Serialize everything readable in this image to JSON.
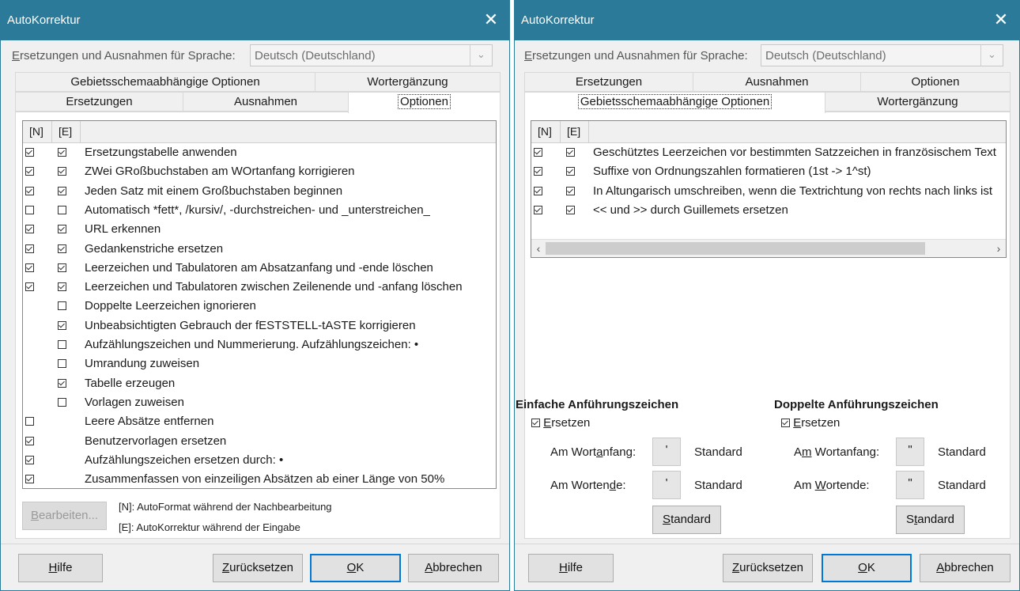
{
  "left": {
    "title": "AutoKorrektur",
    "lang_label": "Ersetzungen und Ausnahmen für Sprache:",
    "lang_label_mnemonic": "E",
    "lang_label_rest": "rsetzungen und Ausnahmen für Sprache:",
    "lang_value": "Deutsch (Deutschland)",
    "tabs_top": [
      "Gebietsschemaabhängige Optionen",
      "Wortergänzung"
    ],
    "tabs_bottom": [
      "Ersetzungen",
      "Ausnahmen",
      "Optionen"
    ],
    "col_n": "[N]",
    "col_e": "[E]",
    "rows": [
      {
        "n": true,
        "e": true,
        "text": "Ersetzungstabelle anwenden"
      },
      {
        "n": true,
        "e": true,
        "text": "ZWei GRoßbuchstaben am WOrtanfang korrigieren"
      },
      {
        "n": true,
        "e": true,
        "text": "Jeden Satz mit einem Großbuchstaben beginnen"
      },
      {
        "n": false,
        "e": false,
        "text": "Automatisch *fett*, /kursiv/, -durchstreichen- und _unterstreichen_"
      },
      {
        "n": true,
        "e": true,
        "text": "URL erkennen"
      },
      {
        "n": true,
        "e": true,
        "text": "Gedankenstriche ersetzen"
      },
      {
        "n": true,
        "e": true,
        "text": "Leerzeichen und Tabulatoren am Absatzanfang und -ende löschen"
      },
      {
        "n": true,
        "e": true,
        "text": "Leerzeichen und Tabulatoren zwischen Zeilenende und -anfang löschen"
      },
      {
        "n": null,
        "e": false,
        "text": "Doppelte Leerzeichen ignorieren"
      },
      {
        "n": null,
        "e": true,
        "text": "Unbeabsichtigten Gebrauch der fESTSTELL-tASTE korrigieren"
      },
      {
        "n": null,
        "e": false,
        "text": "Aufzählungszeichen und Nummerierung. Aufzählungszeichen: •"
      },
      {
        "n": null,
        "e": false,
        "text": "Umrandung zuweisen"
      },
      {
        "n": null,
        "e": true,
        "text": "Tabelle erzeugen"
      },
      {
        "n": null,
        "e": false,
        "text": "Vorlagen zuweisen"
      },
      {
        "n": false,
        "e": null,
        "text": "Leere Absätze entfernen"
      },
      {
        "n": true,
        "e": null,
        "text": "Benutzervorlagen ersetzen"
      },
      {
        "n": true,
        "e": null,
        "text": "Aufzählungszeichen ersetzen durch: •"
      },
      {
        "n": true,
        "e": null,
        "text": "Zusammenfassen von einzeiligen Absätzen ab einer Länge von 50%"
      }
    ],
    "edit_button": "Bearbeiten...",
    "legend_n": "[N]: AutoFormat während der Nachbearbeitung",
    "legend_e": "[E]: AutoKorrektur während der Eingabe",
    "buttons": {
      "help": "Hilfe",
      "reset": "Zurücksetzen",
      "ok": "OK",
      "cancel": "Abbrechen"
    }
  },
  "right": {
    "title": "AutoKorrektur",
    "lang_label": "Ersetzungen und Ausnahmen für Sprache:",
    "lang_value": "Deutsch (Deutschland)",
    "tabs_top": [
      "Ersetzungen",
      "Ausnahmen",
      "Optionen"
    ],
    "tabs_bottom": [
      "Gebietsschemaabhängige Optionen",
      "Wortergänzung"
    ],
    "col_n": "[N]",
    "col_e": "[E]",
    "rows": [
      {
        "n": true,
        "e": true,
        "text": "Geschütztes Leerzeichen vor bestimmten Satzzeichen in französischem Text"
      },
      {
        "n": true,
        "e": true,
        "text": "Suffixe von Ordnungszahlen formatieren (1st -> 1^st)"
      },
      {
        "n": true,
        "e": true,
        "text": "In Altungarisch umschreiben, wenn die Textrichtung von rechts nach links ist"
      },
      {
        "n": true,
        "e": true,
        "text": "<< und >> durch Guillemets ersetzen"
      }
    ],
    "single": {
      "heading": "Einfache Anführungszeichen",
      "replace_label": "Ersetzen",
      "replace_checked": true,
      "start_label": "Am Wortanfang:",
      "start_char": "'",
      "start_value": "Standard",
      "end_label": "Am Wortende:",
      "end_char": "'",
      "end_value": "Standard",
      "default_button": "Standard"
    },
    "double": {
      "heading": "Doppelte Anführungszeichen",
      "replace_label": "Ersetzen",
      "replace_checked": true,
      "start_label": "Am Wortanfang:",
      "start_char": "\"",
      "start_value": "Standard",
      "end_label": "Am Wortende:",
      "end_char": "\"",
      "end_value": "Standard",
      "default_button": "Standard"
    },
    "buttons": {
      "help": "Hilfe",
      "reset": "Zurücksetzen",
      "ok": "OK",
      "cancel": "Abbrechen"
    }
  },
  "colors": {
    "titlebar": "#2b7a99",
    "focus_border": "#0078d7",
    "dialog_bg": "#f0f0f0"
  }
}
